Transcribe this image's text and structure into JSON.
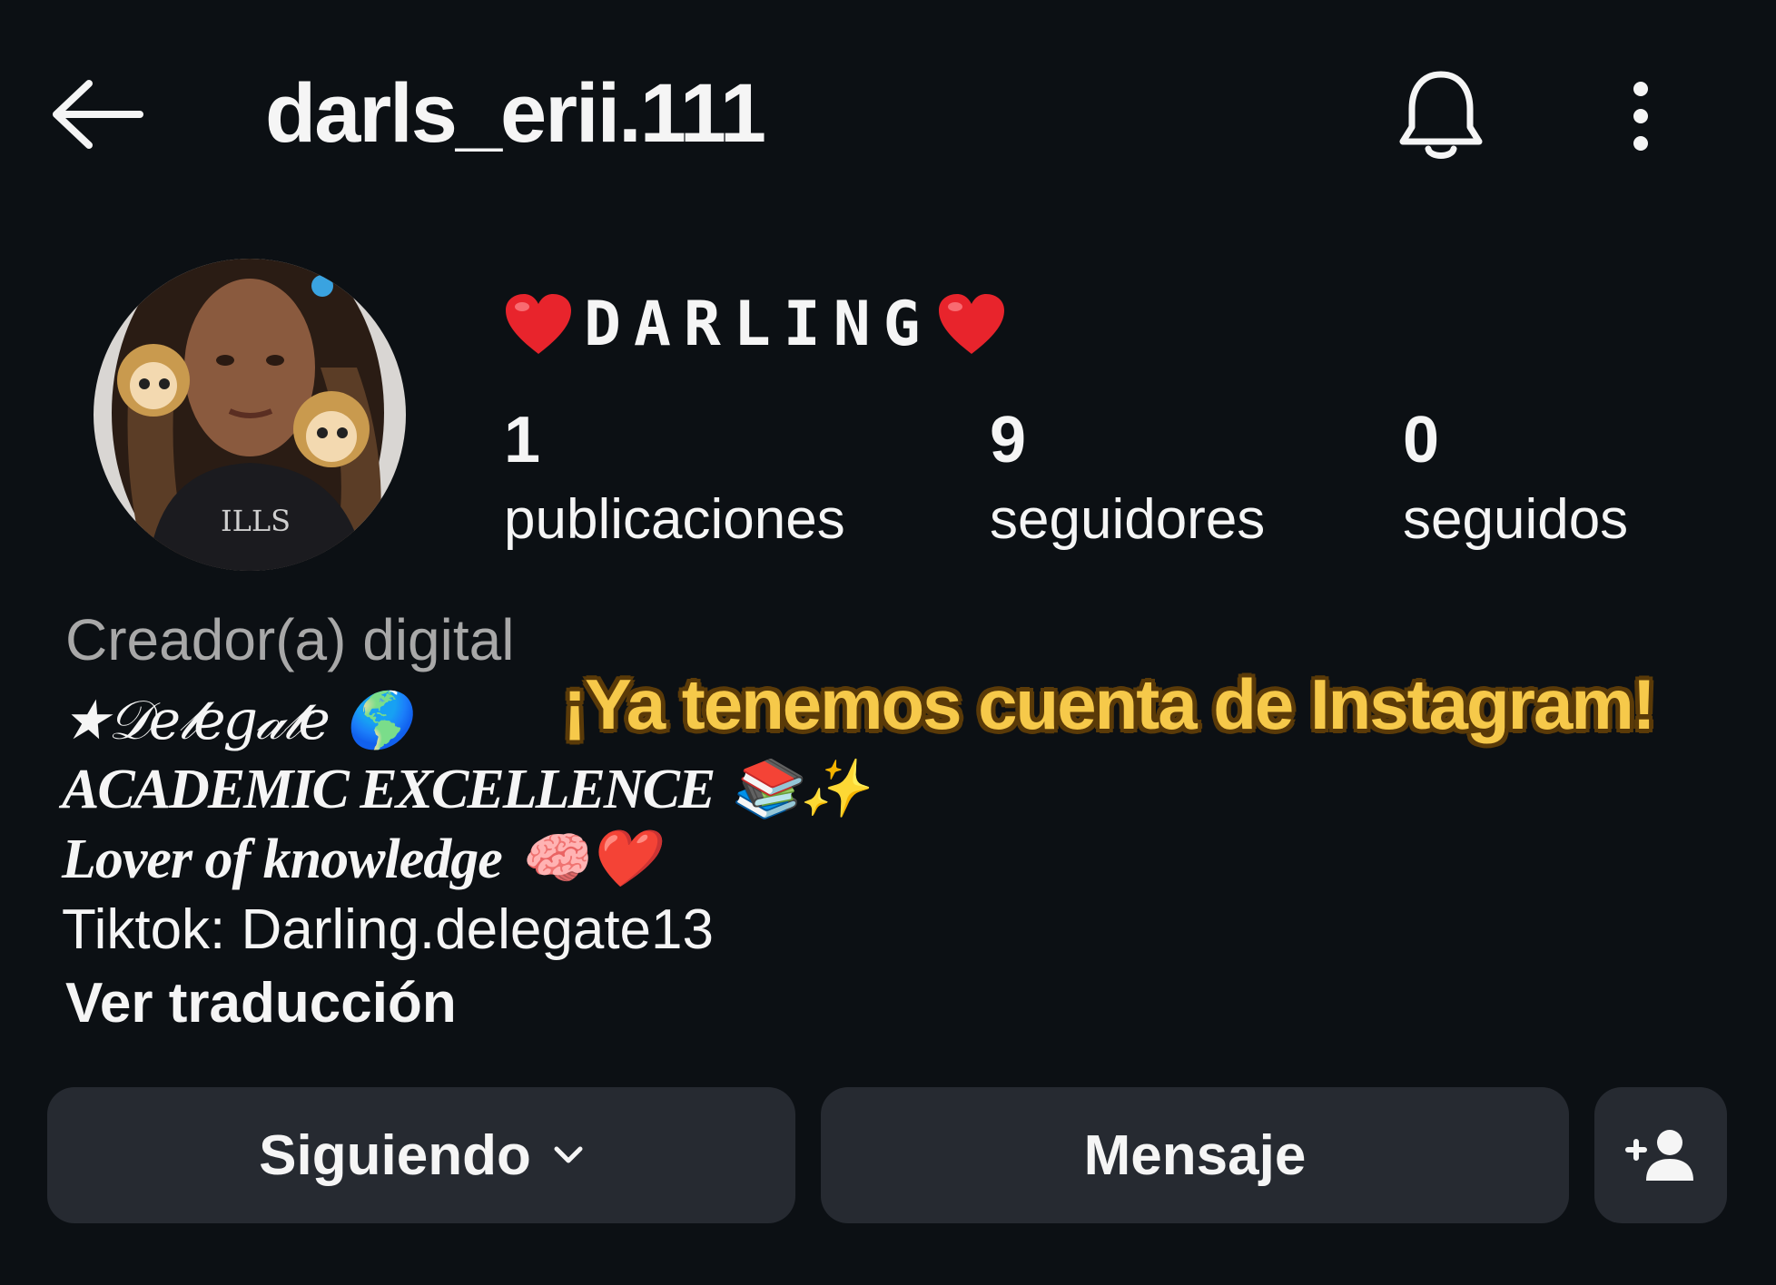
{
  "header": {
    "username": "darls_erii.111",
    "icons": [
      "arrow-left-icon",
      "bell-icon",
      "more-vertical-icon"
    ]
  },
  "profile": {
    "display_name": "DARLING",
    "display_name_emoji": "red-heart",
    "stats": {
      "posts": {
        "value": "1",
        "label": "publicaciones"
      },
      "followers": {
        "value": "9",
        "label": "seguidores"
      },
      "following": {
        "value": "0",
        "label": "seguidos"
      }
    },
    "category": "Creador(a) digital",
    "bio": {
      "delegate": "★𝒟𝑒𝓁𝑒𝑔𝒶𝓉𝑒",
      "delegate_emoji": "🌎",
      "academic": "ACADEMIC EXCELLENCE",
      "academic_emoji": "📚✨",
      "lover": "Lover of knowledge",
      "lover_emoji": "🧠❤️",
      "tiktok": "Tiktok: Darling.delegate13"
    },
    "translate_link": "Ver traducción"
  },
  "overlay": {
    "caption": "¡Ya tenemos cuenta de Instagram!",
    "color": "#f6c94a"
  },
  "actions": {
    "following_label": "Siguiendo",
    "message_label": "Mensaje",
    "add_user_icon": "add-user-icon"
  },
  "colors": {
    "background": "#0c1014",
    "button_bg": "#262a31",
    "text": "#f5f5f5",
    "muted": "#a8a8a8",
    "heart": "#e8242c"
  }
}
